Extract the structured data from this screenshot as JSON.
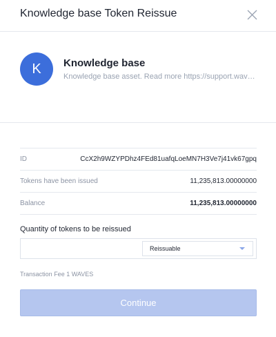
{
  "dialog": {
    "title": "Knowledge base Token Reissue"
  },
  "asset": {
    "avatar_letter": "K",
    "name": "Knowledge base",
    "description": "Knowledge base asset. Read more https://support.wavesplatform.com",
    "avatar_color": "#3c6edb"
  },
  "info": {
    "rows": [
      {
        "label": "ID",
        "value": "CcX2h9WZYPDhz4FEd81uafqLoeMN7H3Ve7j41vk67gpq"
      },
      {
        "label": "Tokens have been issued",
        "value": "11,235,813.00000000"
      },
      {
        "label": "Balance",
        "value": "11,235,813.00000000"
      }
    ]
  },
  "quantity": {
    "label": "Quantity of tokens to be reissued",
    "value": "",
    "placeholder": "",
    "select_value": "Reissuable"
  },
  "fee": {
    "text": "Transaction Fee 1 WAVES"
  },
  "actions": {
    "continue_label": "Continue"
  }
}
